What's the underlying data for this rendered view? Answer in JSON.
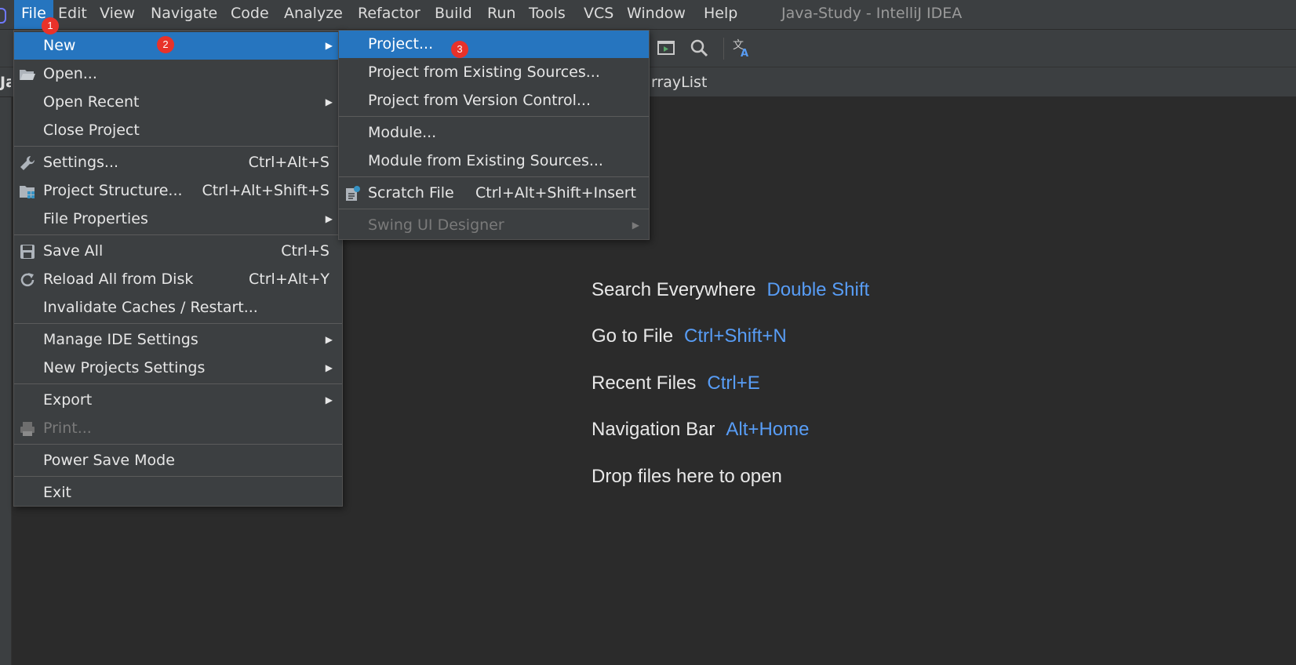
{
  "window": {
    "title": "Java-Study - IntelliJ IDEA"
  },
  "menubar": {
    "items": [
      "File",
      "Edit",
      "View",
      "Navigate",
      "Code",
      "Analyze",
      "Refactor",
      "Build",
      "Run",
      "Tools",
      "VCS",
      "Window",
      "Help"
    ],
    "active": "File"
  },
  "navbar": {
    "crumb": "rrayList",
    "crumb_left": "Ja"
  },
  "file_menu": {
    "items": [
      {
        "label": "New",
        "arrow": "▶",
        "selected": true
      },
      {
        "label": "Open..."
      },
      {
        "label": "Open Recent",
        "arrow": "▶"
      },
      {
        "label": "Close Project"
      },
      {
        "label": "Settings...",
        "shortcut": "Ctrl+Alt+S"
      },
      {
        "label": "Project Structure...",
        "shortcut": "Ctrl+Alt+Shift+S"
      },
      {
        "label": "File Properties",
        "arrow": "▶"
      },
      {
        "label": "Save All",
        "shortcut": "Ctrl+S"
      },
      {
        "label": "Reload All from Disk",
        "shortcut": "Ctrl+Alt+Y"
      },
      {
        "label": "Invalidate Caches / Restart..."
      },
      {
        "label": "Manage IDE Settings",
        "arrow": "▶"
      },
      {
        "label": "New Projects Settings",
        "arrow": "▶"
      },
      {
        "label": "Export",
        "arrow": "▶"
      },
      {
        "label": "Print...",
        "disabled": true
      },
      {
        "label": "Power Save Mode"
      },
      {
        "label": "Exit"
      }
    ]
  },
  "new_submenu": {
    "items": [
      {
        "label": "Project...",
        "selected": true
      },
      {
        "label": "Project from Existing Sources..."
      },
      {
        "label": "Project from Version Control..."
      },
      {
        "label": "Module..."
      },
      {
        "label": "Module from Existing Sources..."
      },
      {
        "label": "Scratch File",
        "shortcut": "Ctrl+Alt+Shift+Insert"
      },
      {
        "label": "Swing UI Designer",
        "arrow": "▶",
        "disabled": true
      }
    ]
  },
  "hints": [
    {
      "label": "Search Everywhere",
      "key": "Double Shift"
    },
    {
      "label": "Go to File",
      "key": "Ctrl+Shift+N"
    },
    {
      "label": "Recent Files",
      "key": "Ctrl+E"
    },
    {
      "label": "Navigation Bar",
      "key": "Alt+Home"
    },
    {
      "label": "Drop files here to open",
      "key": ""
    }
  ],
  "badges": [
    "1",
    "2",
    "3"
  ],
  "colors": {
    "selection": "#2675bf",
    "shortcut_key": "#589df6",
    "badge": "#e8322a"
  }
}
